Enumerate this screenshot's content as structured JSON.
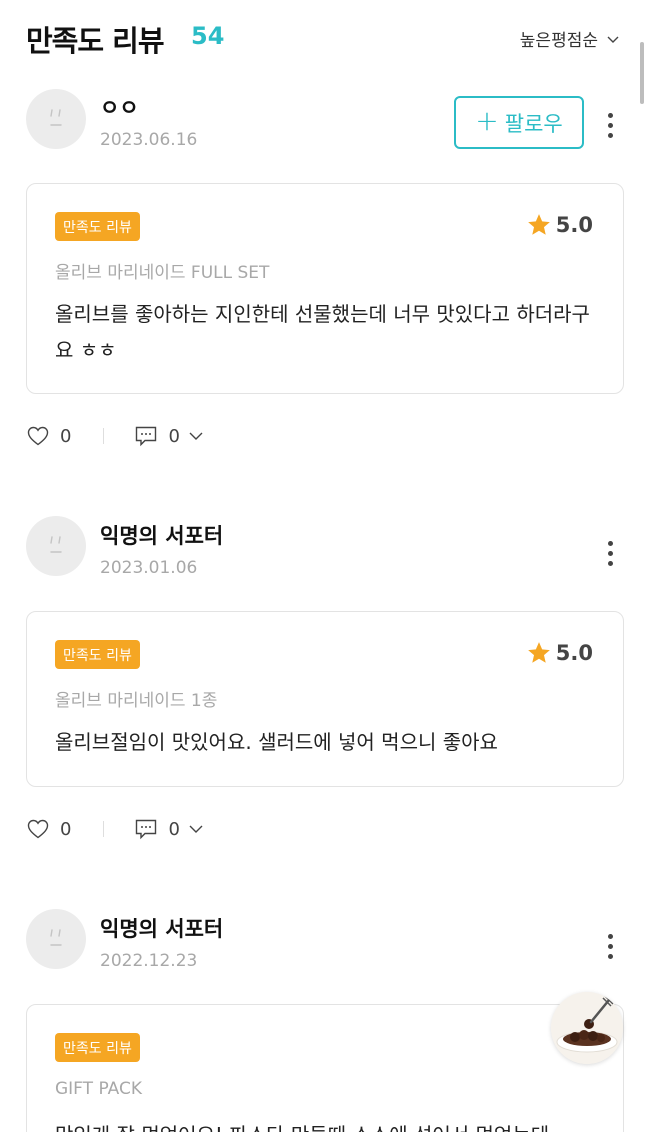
{
  "header": {
    "title": "만족도 리뷰",
    "count": "54",
    "sort_label": "높은평점순"
  },
  "follow_label": "팔로우",
  "reviews": [
    {
      "username": "ㅇㅇ",
      "date": "2023.06.16",
      "badge": "만족도 리뷰",
      "rating": "5.0",
      "product": "올리브 마리네이드 FULL SET",
      "content": "올리브를 좋아하는 지인한테 선물했는데 너무 맛있다고 하더라구요 ㅎㅎ",
      "likes": "0",
      "comments": "0"
    },
    {
      "username": "익명의 서포터",
      "date": "2023.01.06",
      "badge": "만족도 리뷰",
      "rating": "5.0",
      "product": "올리브 마리네이드 1종",
      "content": "올리브절임이 맛있어요. 샐러드에 넣어 먹으니 좋아요",
      "likes": "0",
      "comments": "0"
    },
    {
      "username": "익명의 서포터",
      "date": "2022.12.23",
      "badge": "만족도 리뷰",
      "product": "GIFT PACK",
      "content": "맛있게 잘 먹었어요! 파스타 만들때 소스에 섞어서 먹었는데"
    }
  ],
  "colors": {
    "accent": "#2bbcc6",
    "badge": "#f5a623",
    "star": "#f5a623"
  }
}
